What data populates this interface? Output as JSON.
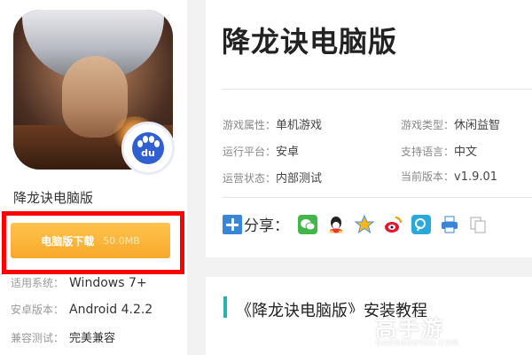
{
  "app": {
    "name": "降龙诀电脑版",
    "download": {
      "label": "电脑版下载",
      "size": "50.0MB"
    },
    "specs": [
      {
        "key": "适用系统：",
        "value": "Windows 7+"
      },
      {
        "key": "安卓版本：",
        "value": "Android 4.2.2"
      },
      {
        "key": "兼容测试：",
        "value": "完美兼容"
      }
    ],
    "badge_icon": "baidu-paw-icon",
    "badge_text": "du"
  },
  "header": {
    "title": "降龙诀电脑版"
  },
  "attributes": [
    {
      "key": "游戏属性：",
      "value": "单机游戏"
    },
    {
      "key": "游戏类型：",
      "value": "休闲益智"
    },
    {
      "key": "运行平台：",
      "value": "安卓"
    },
    {
      "key": "支持语言：",
      "value": "中文"
    },
    {
      "key": "运营状态：",
      "value": "内部测试"
    },
    {
      "key": "当前版本：",
      "value": "v1.9.01"
    }
  ],
  "share": {
    "label": "分享：",
    "icons": [
      "wechat-icon",
      "qq-icon",
      "qzone-icon",
      "weibo-icon",
      "tencent-weibo-icon",
      "print-icon",
      "copy-icon"
    ]
  },
  "tutorial": {
    "title": "《降龙诀电脑版》安装教程"
  },
  "watermark": {
    "text": "高手游",
    "sub": "GAOSHOUYOU.COM"
  },
  "colors": {
    "download_button": "#f7a92a",
    "highlight_frame": "#ff0000",
    "accent_bar": "#1fb5b0",
    "share_plus": "#3a86d6"
  }
}
